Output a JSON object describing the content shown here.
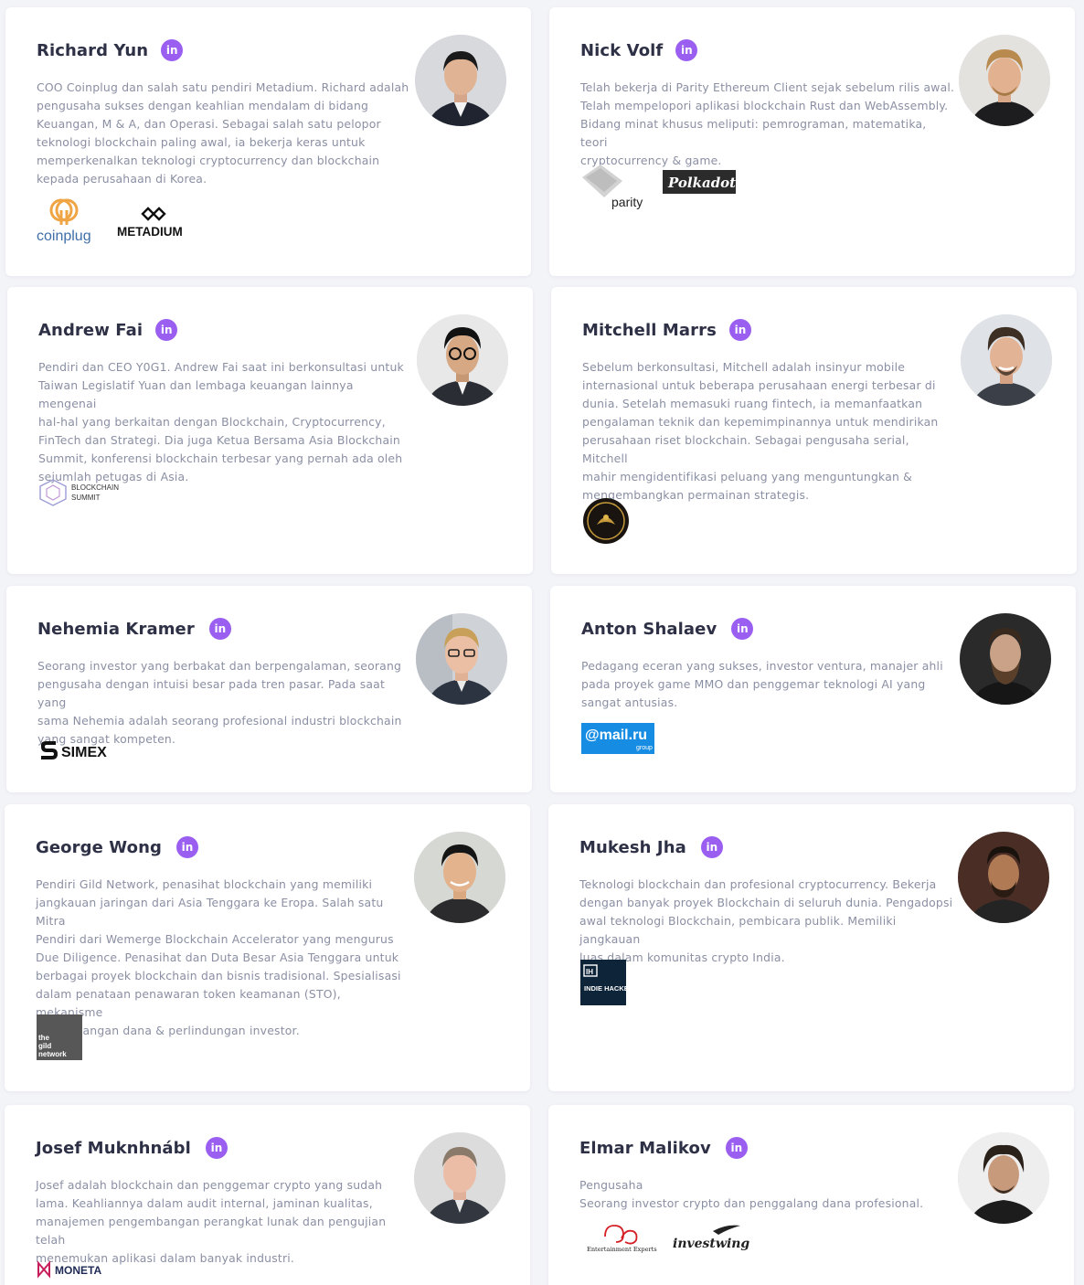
{
  "linkedin_glyph": "in",
  "team": [
    {
      "name": "Richard Yun",
      "desc": [
        "COO Coinplug dan salah satu pendiri Metadium. Richard adalah",
        "pengusaha sukses dengan keahlian mendalam di bidang",
        "Keuangan, M & A, dan Operasi. Sebagai salah satu pelopor",
        "teknologi blockchain paling awal, ia bekerja keras untuk",
        "memperkenalkan teknologi cryptocurrency dan blockchain",
        "kepada perusahaan di Korea."
      ],
      "logos": [
        "coinplug",
        "METADIUM"
      ]
    },
    {
      "name": "Nick Volf",
      "desc": [
        "Telah bekerja di Parity Ethereum Client sejak sebelum rilis awal.",
        "Telah mempelopori aplikasi blockchain Rust dan WebAssembly.",
        "Bidang minat khusus meliputi: pemrograman, matematika, teori",
        "cryptocurrency & game."
      ],
      "logos": [
        "parity",
        "Polkadot."
      ]
    },
    {
      "name": "Andrew Fai",
      "desc": [
        "Pendiri dan CEO Y0G1. Andrew Fai saat ini berkonsultasi untuk",
        "Taiwan Legislatif Yuan dan lembaga keuangan lainnya mengenai",
        "hal-hal yang berkaitan dengan Blockchain, Cryptocurrency,",
        "FinTech dan Strategi. Dia juga Ketua Bersama Asia Blockchain",
        "Summit, konferensi blockchain terbesar yang pernah ada oleh",
        "sejumlah petugas di Asia."
      ],
      "logos": [
        "BLOCKCHAIN SUMMIT"
      ]
    },
    {
      "name": "Mitchell Marrs",
      "desc": [
        "Sebelum berkonsultasi, Mitchell adalah insinyur mobile",
        "internasional untuk beberapa perusahaan energi terbesar di",
        "dunia. Setelah memasuki ruang fintech, ia memanfaatkan",
        "pengalaman teknik dan kepemimpinannya untuk mendirikan",
        "perusahaan riset blockchain. Sebagai pengusaha serial, Mitchell",
        "mahir mengidentifikasi peluang yang menguntungkan &",
        "mengembangkan permainan strategis."
      ],
      "logos": [
        "emblem"
      ]
    },
    {
      "name": "Nehemia Kramer",
      "desc": [
        "Seorang investor yang berbakat dan berpengalaman, seorang",
        "pengusaha dengan intuisi besar pada tren pasar. Pada saat yang",
        "sama Nehemia adalah seorang profesional industri blockchain",
        "yang sangat kompeten."
      ],
      "logos": [
        "SIMEX"
      ]
    },
    {
      "name": "Anton Shalaev",
      "desc": [
        "Pedagang eceran yang sukses, investor ventura, manajer ahli",
        "pada proyek game MMO dan penggemar teknologi AI yang",
        "sangat antusias."
      ],
      "logos": [
        "@mail.ru group"
      ]
    },
    {
      "name": "George Wong",
      "desc": [
        "Pendiri Gild Network, penasihat blockchain yang memiliki",
        "jangkauan jaringan dari Asia Tenggara ke Eropa. Salah satu Mitra",
        "Pendiri dari Wemerge Blockchain Accelerator yang mengurus",
        "Due Diligence. Penasihat dan Duta Besar Asia Tenggara untuk",
        "berbagai proyek blockchain dan bisnis tradisional. Spesialisasi",
        "dalam penataan penawaran token keamanan (STO), mekanisme",
        "penggalangan dana & perlindungan investor."
      ],
      "logos": [
        "the gild network"
      ]
    },
    {
      "name": "Mukesh Jha",
      "desc": [
        "Teknologi blockchain dan profesional cryptocurrency. Bekerja",
        "dengan banyak proyek Blockchain di seluruh dunia. Pengadopsi",
        "awal teknologi Blockchain, pembicara publik. Memiliki jangkauan",
        "luas dalam komunitas crypto India."
      ],
      "logos": [
        "INDIE HACKERS"
      ]
    },
    {
      "name": "Josef Muknhnábl",
      "desc": [
        "Josef adalah blockchain dan penggemar crypto yang sudah",
        "lama. Keahliannya dalam audit internal, jaminan kualitas,",
        "manajemen pengembangan perangkat lunak dan pengujian telah",
        "menemukan aplikasi dalam banyak industri."
      ],
      "logos": [
        "MONETA"
      ]
    },
    {
      "name": "Elmar Malikov",
      "desc": [
        "Pengusaha",
        "Seorang investor crypto dan penggalang dana profesional."
      ],
      "logos": [
        "Entertainment Experts",
        "investwing"
      ]
    }
  ],
  "colors": {
    "linkedin": "#9a5ff0",
    "name": "#2e3146",
    "desc": "#8a8fa3",
    "background": "#f3f4f8"
  }
}
